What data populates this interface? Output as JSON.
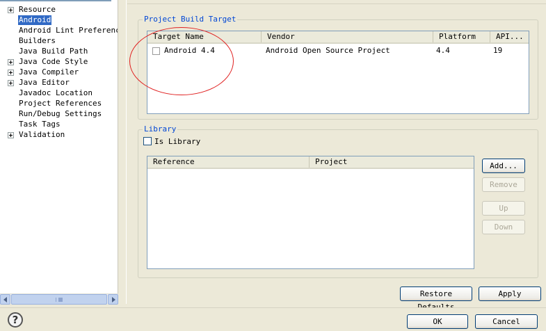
{
  "tree": {
    "items": [
      {
        "label": "Resource",
        "expandable": true
      },
      {
        "label": "Android",
        "expandable": false,
        "selected": true
      },
      {
        "label": "Android Lint Preferences",
        "expandable": false
      },
      {
        "label": "Builders",
        "expandable": false
      },
      {
        "label": "Java Build Path",
        "expandable": false
      },
      {
        "label": "Java Code Style",
        "expandable": true
      },
      {
        "label": "Java Compiler",
        "expandable": true
      },
      {
        "label": "Java Editor",
        "expandable": true
      },
      {
        "label": "Javadoc Location",
        "expandable": false
      },
      {
        "label": "Project References",
        "expandable": false
      },
      {
        "label": "Run/Debug Settings",
        "expandable": false
      },
      {
        "label": "Task Tags",
        "expandable": false
      },
      {
        "label": "Validation",
        "expandable": true
      }
    ]
  },
  "build_target": {
    "title": "Project Build Target",
    "columns": [
      "Target Name",
      "Vendor",
      "Platform",
      "API..."
    ],
    "rows": [
      {
        "name": "Android 4.4",
        "vendor": "Android Open Source Project",
        "platform": "4.4",
        "api": "19",
        "checked": false
      }
    ]
  },
  "library": {
    "title": "Library",
    "is_library_label": "Is Library",
    "is_library_checked": false,
    "columns": [
      "Reference",
      "Project"
    ],
    "buttons": {
      "add": "Add...",
      "remove": "Remove",
      "up": "Up",
      "down": "Down"
    }
  },
  "footer": {
    "restore_defaults": "Restore Defaults",
    "apply": "Apply",
    "ok": "OK",
    "cancel": "Cancel",
    "help_symbol": "?"
  },
  "colors": {
    "group_title": "#0046d5",
    "selection": "#316ac5",
    "annotation": "#e02020"
  }
}
